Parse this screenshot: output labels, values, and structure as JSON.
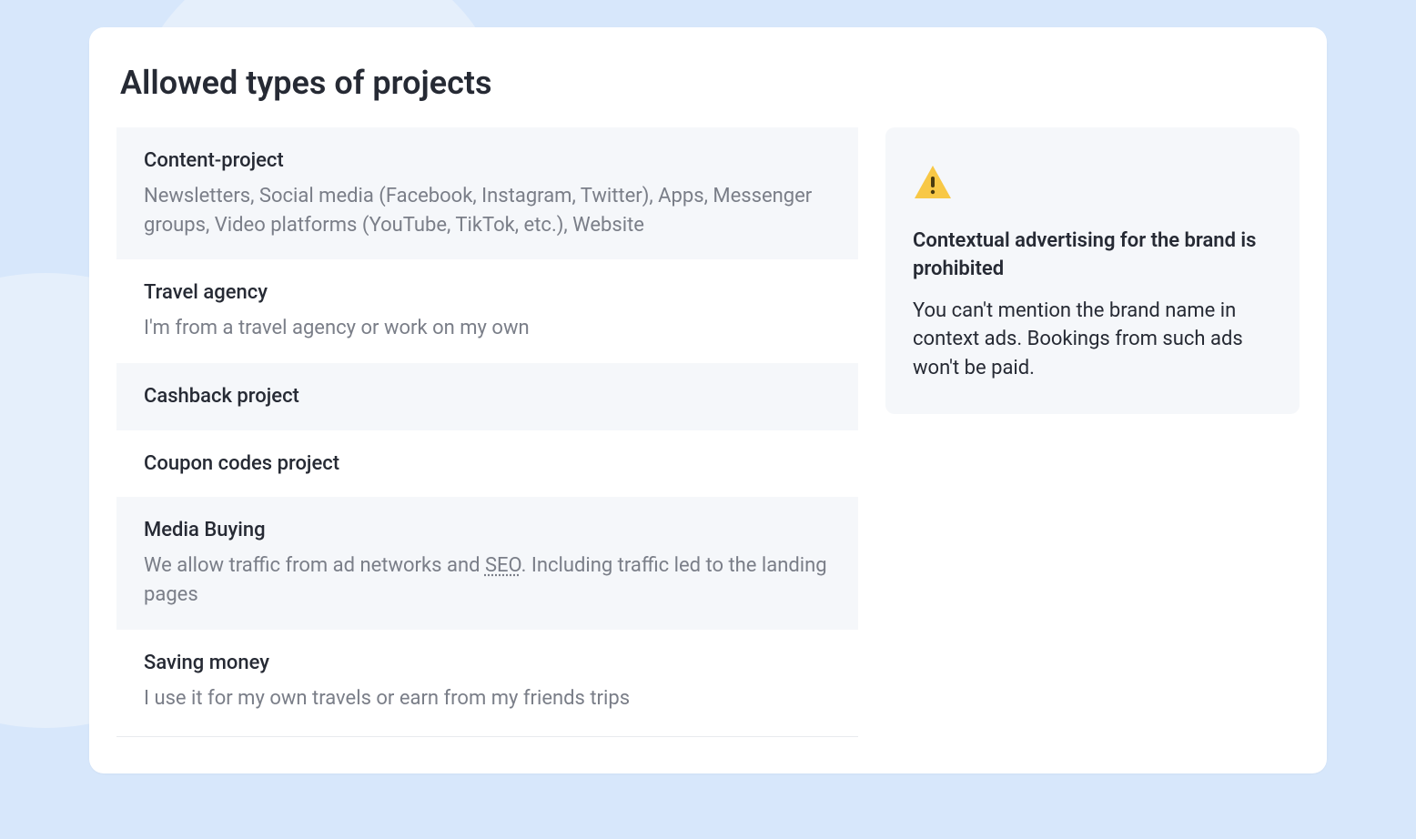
{
  "title": "Allowed types of projects",
  "items": [
    {
      "title": "Content-project",
      "desc": "Newsletters, Social media (Facebook, Instagram, Twitter), Apps, Messenger groups, Video platforms (YouTube, TikTok, etc.), Website"
    },
    {
      "title": "Travel agency",
      "desc": "I'm from a travel agency or work on my own"
    },
    {
      "title": "Cashback project",
      "desc": ""
    },
    {
      "title": "Coupon codes project",
      "desc": ""
    },
    {
      "title": "Media Buying",
      "desc_pre": "We allow traffic from ad networks and ",
      "desc_abbr": "SEO",
      "desc_post": ". Including traffic led to the landing pages"
    },
    {
      "title": "Saving money",
      "desc": "I use it for my own travels or earn from my friends trips"
    }
  ],
  "warning": {
    "title": "Contextual advertising for the brand is prohibited",
    "desc": "You can't mention the brand name in context ads. Bookings from such ads won't be paid."
  }
}
